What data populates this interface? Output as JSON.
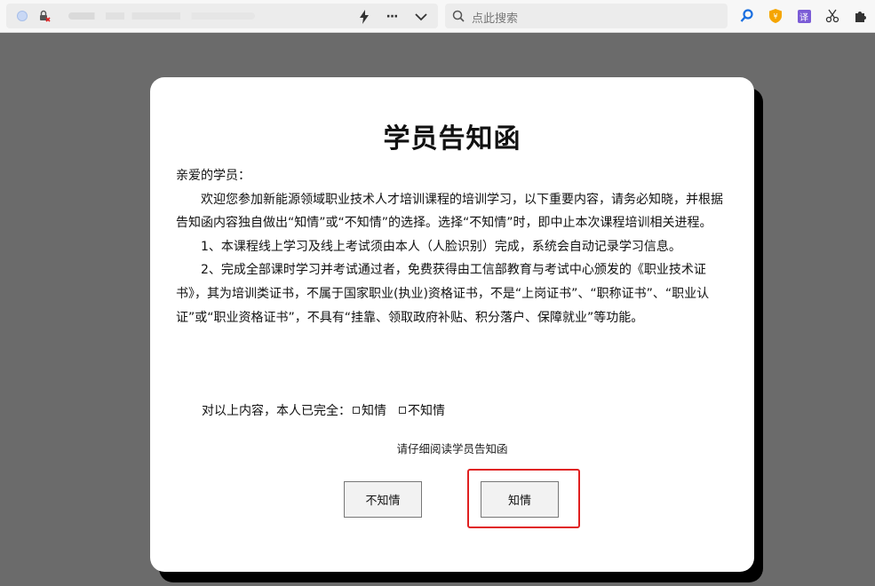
{
  "browser": {
    "search_placeholder": "点此搜索",
    "more_label": "···",
    "ext_translate_label": "译"
  },
  "modal": {
    "title": "学员告知函",
    "greeting": "亲爱的学员：",
    "para1": "欢迎您参加新能源领域职业技术人才培训课程的培训学习，以下重要内容，请务必知晓，并根据告知函内容独自做出“知情”或“不知情”的选择。选择“不知情”时，即中止本次课程培训相关进程。",
    "para2": "1、本课程线上学习及线上考试须由本人（人脸识别）完成，系统会自动记录学习信息。",
    "para3": "2、完成全部课时学习并考试通过者，免费获得由工信部教育与考试中心颁发的《职业技术证书》，其为培训类证书，不属于国家职业(执业)资格证书，不是“上岗证书”、“职称证书”、“职业认证”或“职业资格证书”，不具有“挂靠、领取政府补贴、积分落户、保障就业”等功能。",
    "confirm_prefix": "对以上内容，本人已完全：",
    "option_know": "知情",
    "option_not_know": "不知情",
    "hint": "请仔细阅读学员告知函",
    "button_not_know": "不知情",
    "button_know": "知情"
  },
  "colors": {
    "overlay": "#6b6b6b",
    "highlight": "#e02020"
  }
}
